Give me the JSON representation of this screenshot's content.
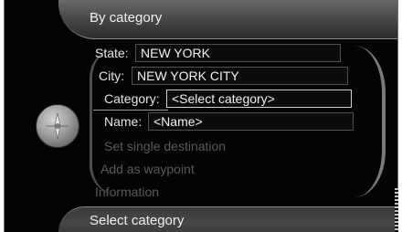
{
  "header": {
    "title": "By category"
  },
  "footer": {
    "title": "Select category"
  },
  "form": {
    "state": {
      "label": "State:",
      "value": "NEW YORK"
    },
    "city": {
      "label": "City:",
      "value": "NEW YORK CITY"
    },
    "category": {
      "label": "Category:",
      "value": "<Select category>"
    },
    "name": {
      "label": "Name:",
      "value": "<Name>"
    }
  },
  "menu": {
    "set_single_destination": "Set single destination",
    "add_as_waypoint": "Add as waypoint",
    "information": "Information"
  },
  "knob": {
    "icon": "navigation-knob-icon"
  }
}
